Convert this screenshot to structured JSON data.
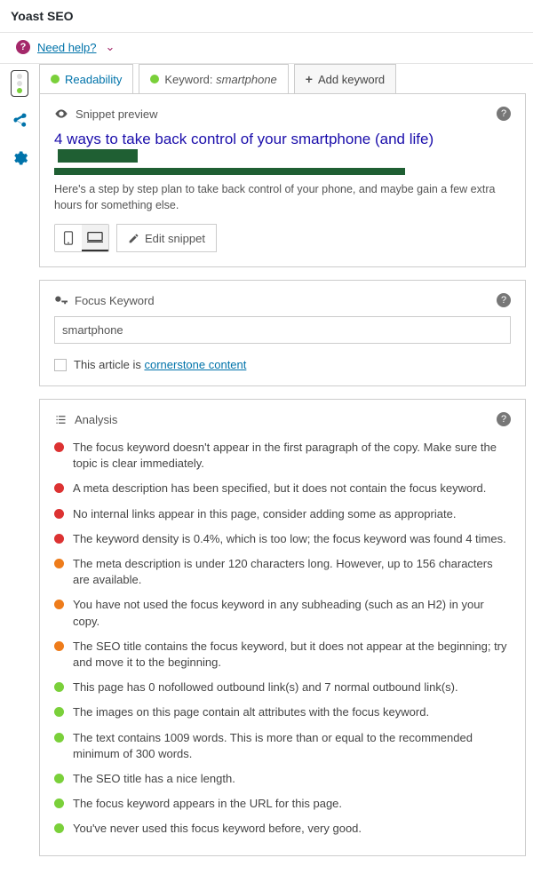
{
  "header": {
    "title": "Yoast SEO"
  },
  "help": {
    "need_help": "Need help?",
    "icon": "?"
  },
  "tabs": {
    "readability": "Readability",
    "keyword_prefix": "Keyword: ",
    "keyword_value": "smartphone",
    "add_keyword": "Add keyword"
  },
  "snippet": {
    "heading": "Snippet preview",
    "title": "4 ways to take back control of your smartphone (and life)",
    "description": "Here's a step by step plan to take back control of your phone, and maybe gain a few extra hours for something else.",
    "edit_label": "Edit snippet"
  },
  "focus": {
    "heading": "Focus Keyword",
    "value": "smartphone",
    "cornerstone_text": "This article is ",
    "cornerstone_link": "cornerstone content"
  },
  "analysis": {
    "heading": "Analysis",
    "items": [
      {
        "c": "red",
        "t": "The focus keyword doesn't appear in the first paragraph of the copy. Make sure the topic is clear immediately."
      },
      {
        "c": "red",
        "t": "A meta description has been specified, but it does not contain the focus keyword."
      },
      {
        "c": "red",
        "t": "No internal links appear in this page, consider adding some as appropriate."
      },
      {
        "c": "red",
        "t": "The keyword density is 0.4%, which is too low; the focus keyword was found 4 times."
      },
      {
        "c": "orange",
        "t": "The meta description is under 120 characters long. However, up to 156 characters are available."
      },
      {
        "c": "orange",
        "t": "You have not used the focus keyword in any subheading (such as an H2) in your copy."
      },
      {
        "c": "orange",
        "t": "The SEO title contains the focus keyword, but it does not appear at the beginning; try and move it to the beginning."
      },
      {
        "c": "green",
        "t": "This page has 0 nofollowed outbound link(s) and 7 normal outbound link(s)."
      },
      {
        "c": "green",
        "t": "The images on this page contain alt attributes with the focus keyword."
      },
      {
        "c": "green",
        "t": "The text contains 1009 words. This is more than or equal to the recommended minimum of 300 words."
      },
      {
        "c": "green",
        "t": "The SEO title has a nice length."
      },
      {
        "c": "green",
        "t": "The focus keyword appears in the URL for this page."
      },
      {
        "c": "green",
        "t": "You've never used this focus keyword before, very good."
      }
    ]
  }
}
